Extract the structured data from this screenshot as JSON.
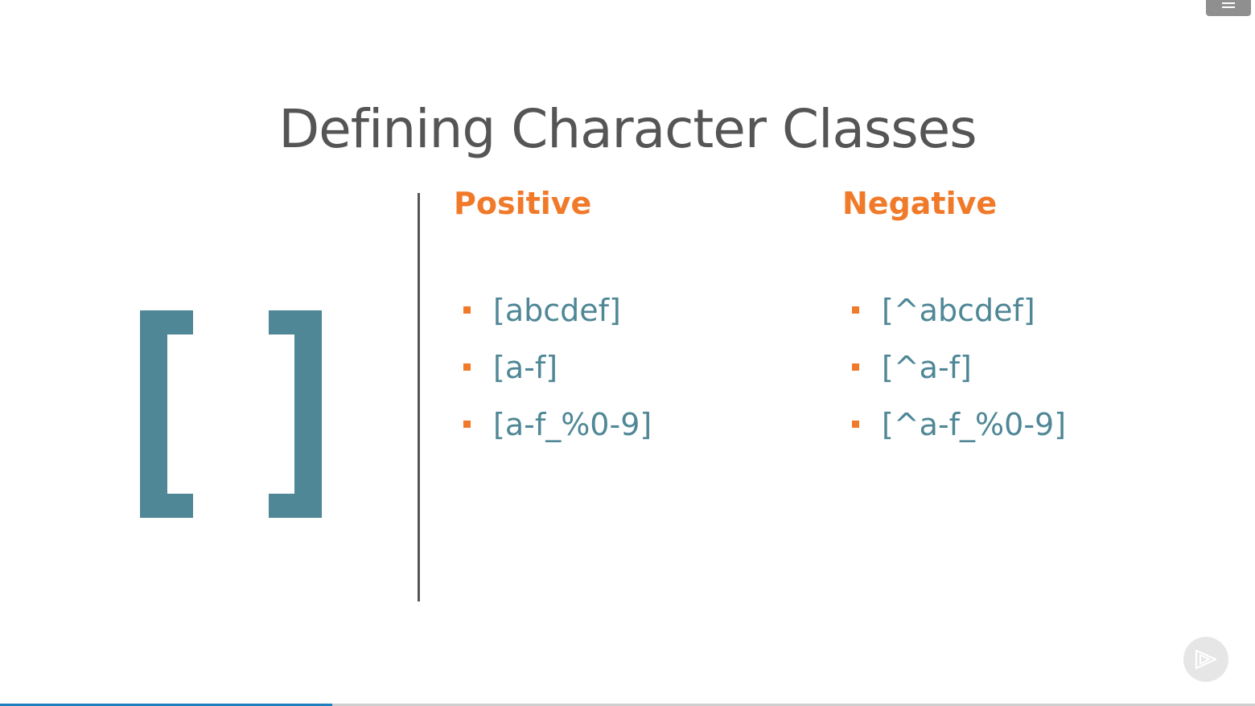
{
  "slide": {
    "title": "Defining Character Classes",
    "positive": {
      "heading": "Positive",
      "items": [
        "[abcdef]",
        "[a-f]",
        "[a-f_%0-9]"
      ]
    },
    "negative": {
      "heading": "Negative",
      "items": [
        "[^abcdef]",
        "[^a-f]",
        "[^a-f_%0-9]"
      ]
    }
  },
  "icons": {
    "brackets": "square-brackets-icon",
    "menu": "hamburger-menu-icon",
    "play": "pluralsight-play-icon"
  },
  "colors": {
    "title": "#555555",
    "accent_orange": "#f07a2a",
    "accent_teal": "#4f8796",
    "progress": "#1e7fbf"
  },
  "player": {
    "progress_fraction": 0.265
  }
}
